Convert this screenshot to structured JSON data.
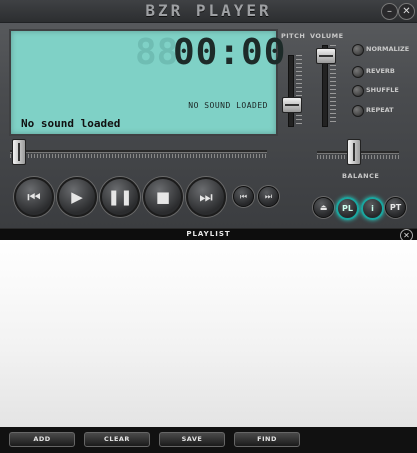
{
  "app": {
    "title": "BZR PLAYER",
    "minimize_glyph": "–",
    "close_glyph": "✕"
  },
  "display": {
    "time_ghost": "88",
    "time": "00:00",
    "status": "NO SOUND LOADED",
    "track": "No sound loaded"
  },
  "labels": {
    "pitch": "PITCH",
    "volume": "VOLUME",
    "balance": "BALANCE"
  },
  "options": [
    {
      "label": "NORMALIZE"
    },
    {
      "label": "REVERB"
    },
    {
      "label": "SHUFFLE"
    },
    {
      "label": "REPEAT"
    }
  ],
  "transport": {
    "prev_icon": "skip-back-icon",
    "play_icon": "play-icon",
    "pause_icon": "pause-icon",
    "stop_icon": "stop-icon",
    "next_icon": "skip-forward-icon",
    "prev_glyph": "⏮",
    "play_glyph": "▶",
    "pause_glyph": "❚❚",
    "stop_glyph": "■",
    "next_glyph": "⏭",
    "small_prev_glyph": "⏮",
    "small_next_glyph": "⏭"
  },
  "right_buttons": {
    "eject_glyph": "⏏",
    "pl": "PL",
    "info": "i",
    "pt": "PT"
  },
  "playlist": {
    "title": "PLAYLIST",
    "close_glyph": "✕",
    "buttons": {
      "add": "ADD",
      "clear": "CLEAR",
      "save": "SAVE",
      "find": "FIND"
    }
  },
  "colors": {
    "lcd": "#7fd1c6",
    "accent": "#1aa7a0"
  }
}
